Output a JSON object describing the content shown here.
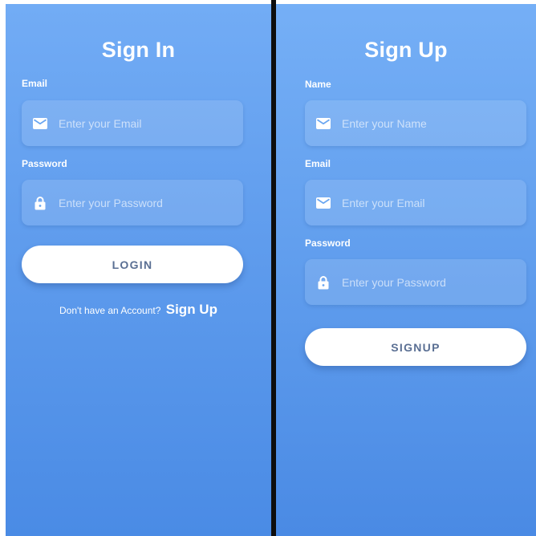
{
  "signin": {
    "title": "Sign In",
    "email_label": "Email",
    "email_placeholder": "Enter your Email",
    "password_label": "Password",
    "password_placeholder": "Enter your Password",
    "button_label": "LOGIN",
    "footer_text": "Don't have an Account?",
    "footer_link": "Sign Up"
  },
  "signup": {
    "title": "Sign Up",
    "name_label": "Name",
    "name_placeholder": "Enter your Name",
    "email_label": "Email",
    "email_placeholder": "Enter your Email",
    "password_label": "Password",
    "password_placeholder": "Enter your Password",
    "button_label": "SIGNUP"
  },
  "icons": {
    "email": "mail-icon",
    "password": "lock-icon"
  },
  "colors": {
    "panel_top": "#72acf5",
    "panel_bottom": "#4a8be5",
    "button_text": "#5a6f93",
    "divider": "#0d0d0d"
  }
}
